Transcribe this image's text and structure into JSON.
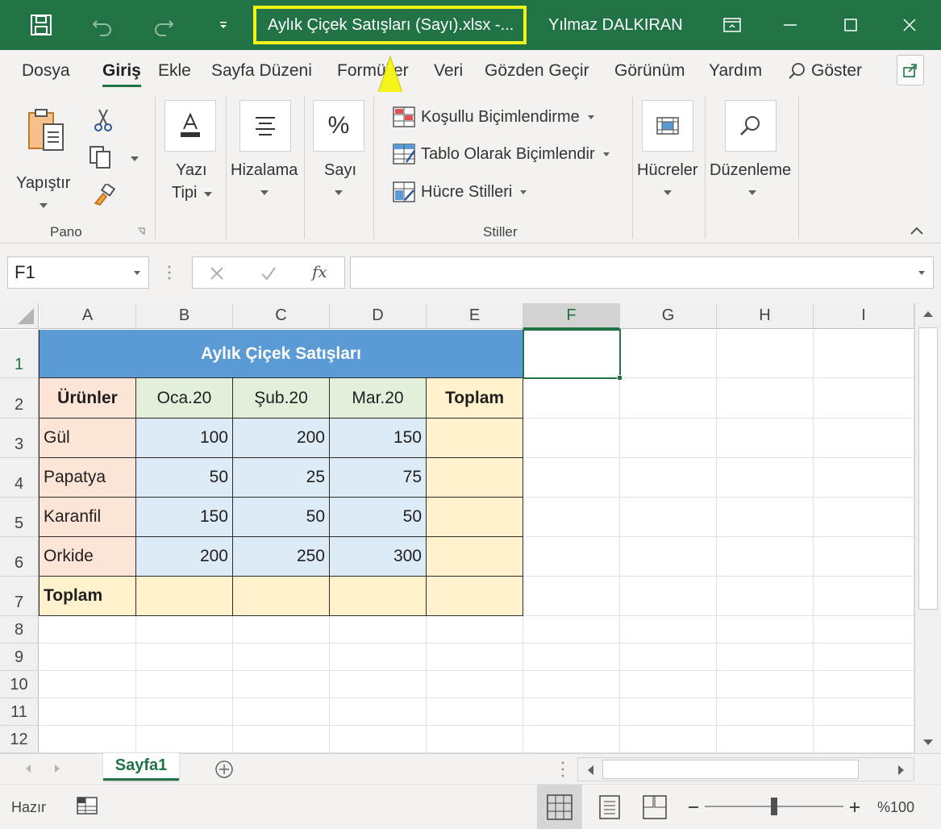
{
  "window": {
    "title": "Aylık Çiçek Satışları (Sayı).xlsx  -...",
    "user": "Yılmaz DALKIRAN",
    "accent_color": "#217346",
    "highlight_color": "#f4f41a",
    "icons": [
      "save-icon",
      "undo-icon",
      "redo-icon",
      "customize-qat-icon",
      "ribbon-display-icon",
      "minimize-icon",
      "maximize-icon",
      "close-icon"
    ]
  },
  "ribbon": {
    "tabs": [
      "Dosya",
      "Giriş",
      "Ekle",
      "Sayfa Düzeni",
      "Formüller",
      "Veri",
      "Gözden Geçir",
      "Görünüm",
      "Yardım"
    ],
    "active_tab": "Giriş",
    "search_label": "Göster",
    "clipboard": {
      "paste_label": "Yapıştır",
      "group_name": "Pano"
    },
    "font": {
      "label_line1": "Yazı",
      "label_line2": "Tipi"
    },
    "alignment": {
      "label": "Hizalama"
    },
    "number": {
      "label": "Sayı"
    },
    "styles": {
      "conditional_formatting": "Koşullu Biçimlendirme",
      "format_as_table": "Tablo Olarak Biçimlendir",
      "cell_styles": "Hücre Stilleri",
      "group_name": "Stiller"
    },
    "cells": {
      "label": "Hücreler"
    },
    "editing": {
      "label": "Düzenleme"
    }
  },
  "formula_bar": {
    "name_box": "F1",
    "fx_label": "fx",
    "formula": ""
  },
  "sheet": {
    "columns": [
      "A",
      "B",
      "C",
      "D",
      "E",
      "F",
      "G",
      "H",
      "I"
    ],
    "rows": [
      "1",
      "2",
      "3",
      "4",
      "5",
      "6",
      "7",
      "8",
      "9",
      "10",
      "11",
      "12"
    ],
    "selected_column": "F",
    "selected_row": "1",
    "table_title": "Aylık Çiçek Satışları",
    "header": [
      "Ürünler",
      "Oca.20",
      "Şub.20",
      "Mar.20",
      "Toplam"
    ],
    "products": [
      {
        "name": "Gül",
        "values": [
          "100",
          "200",
          "150"
        ]
      },
      {
        "name": "Papatya",
        "values": [
          "50",
          "25",
          "75"
        ]
      },
      {
        "name": "Karanfil",
        "values": [
          "150",
          "50",
          "50"
        ]
      },
      {
        "name": "Orkide",
        "values": [
          "200",
          "250",
          "300"
        ]
      }
    ],
    "total_label": "Toplam",
    "colors": {
      "title_fill": "#5b9bd5",
      "product_fill": "#fce4d6",
      "month_header_fill": "#e2efda",
      "value_fill": "#ddebf7",
      "total_fill": "#fff2cc"
    }
  },
  "sheet_tabs": {
    "active": "Sayfa1"
  },
  "status_bar": {
    "status": "Hazır",
    "zoom": "%100"
  }
}
